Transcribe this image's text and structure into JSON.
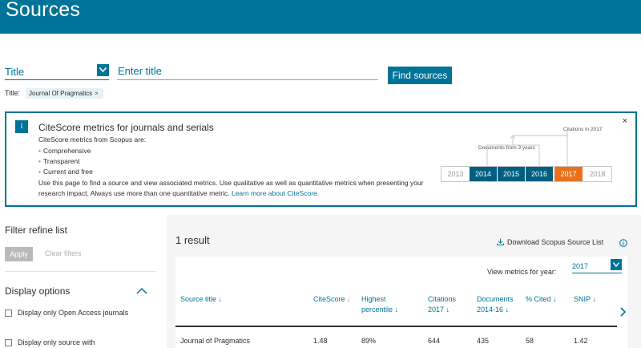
{
  "header": {
    "title": "Sources"
  },
  "search": {
    "field_select": "Title",
    "input_placeholder": "Enter title",
    "find_button": "Find sources"
  },
  "active_filter": {
    "label": "Title:",
    "chip": "Journal Of Pragmatics",
    "chip_remove": "×"
  },
  "metrics_box": {
    "info_glyph": "i",
    "title": "CiteScore metrics for journals and serials",
    "subtitle": "CiteScore metrics from Scopus are:",
    "bullets": [
      "Comprehensive",
      "Transparent",
      "Current and free"
    ],
    "description": "Use this page to find a source and view associated metrics. Use qualitative as well as quantitative metrics when presenting your research impact. Always use more than one quantitative metric.",
    "learn_more": "Learn more about CiteScore.",
    "close": "×",
    "diagram": {
      "years": [
        "2013",
        "2014",
        "2015",
        "2016",
        "2017",
        "2018"
      ],
      "documents_label": "Documents from 3 years",
      "citations_label": "Citations in 2017"
    }
  },
  "filter": {
    "title": "Filter refine list",
    "apply": "Apply",
    "clear": "Clear filters",
    "display_options": "Display options",
    "checkboxes": [
      {
        "label": "Display only Open Access journals",
        "checked": false
      },
      {
        "label": "Display only source with",
        "checked": false
      }
    ]
  },
  "results": {
    "count": "1 result",
    "download": "Download Scopus Source List",
    "view_metrics_label": "View metrics for year:",
    "selected_year": "2017",
    "columns": [
      {
        "line1": "Source title",
        "line2": ""
      },
      {
        "line1": "CiteScore",
        "line2": ""
      },
      {
        "line1": "Highest",
        "line2": "percentile"
      },
      {
        "line1": "Citations",
        "line2": "2017"
      },
      {
        "line1": "Documents",
        "line2": "2014-16"
      },
      {
        "line1": "% Cited",
        "line2": ""
      },
      {
        "line1": "SNIP",
        "line2": ""
      }
    ],
    "rows": [
      {
        "source_title": "Journal of Pragmatics",
        "citescore": "1.48",
        "highest_percentile": "89%",
        "citations": "644",
        "documents": "435",
        "percent_cited": "58",
        "snip": "1.42"
      }
    ]
  },
  "colors": {
    "brand": "#007398",
    "accent": "#e9711c"
  }
}
